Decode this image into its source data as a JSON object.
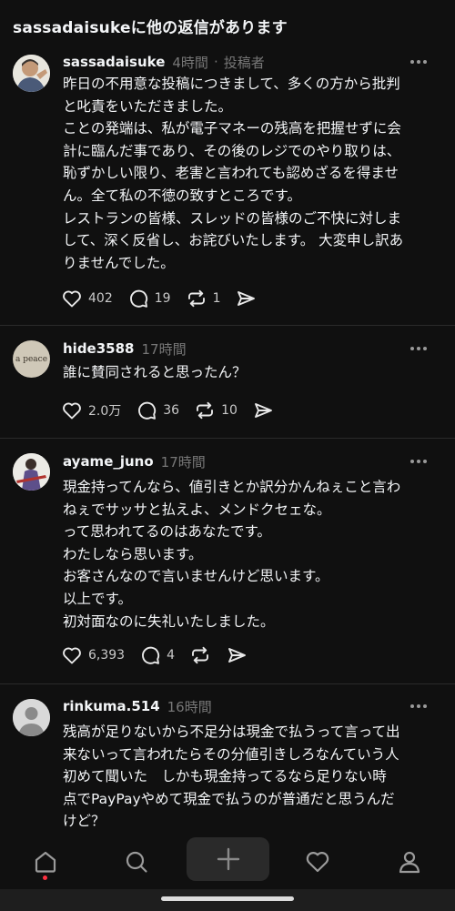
{
  "header": {
    "title": "sassadaisukeに他の返信があります"
  },
  "posts": [
    {
      "username": "sassadaisuke",
      "time": "4時間",
      "author_label": "投稿者",
      "lines": [
        "昨日の不用意な投稿につきまして、多くの方から批判",
        "と叱責をいただきました。",
        "ことの発端は、私が電子マネーの残高を把握せずに会",
        "計に臨んだ事であり、その後のレジでのやり取りは、",
        "恥ずかしい限り、老害と言われても認めざるを得ませ",
        "ん。全て私の不徳の致すところです。",
        "レストランの皆様、スレッドの皆様のご不快に対しま",
        "して、深く反省し、お詫びいたします。 大変申し訳あ",
        "りませんでした。"
      ],
      "likes": "402",
      "replies": "19",
      "reposts": "1"
    },
    {
      "username": "hide3588",
      "time": "17時間",
      "avatar_text": "a peace",
      "lines": [
        "誰に賛同されると思ったん？"
      ],
      "likes": "2.0万",
      "replies": "36",
      "reposts": "10"
    },
    {
      "username": "ayame_juno",
      "time": "17時間",
      "lines": [
        "現金持ってんなら、値引きとか訳分かんねぇこと言わ",
        "ねぇでサッサと払えよ、メンドクセェな。",
        "って思われてるのはあなたです。",
        "わたしなら思います。",
        "お客さんなので言いませんけど思います。",
        "以上です。",
        "初対面なのに失礼いたしました。"
      ],
      "likes": "6,393",
      "replies": "4",
      "reposts": ""
    },
    {
      "username": "rinkuma.514",
      "time": "16時間",
      "lines": [
        "残高が足りないから不足分は現金で払うって言って出",
        "来ないって言われたらその分値引きしろなんていう人",
        "初めて聞いた　しかも現金持ってるなら足りない時",
        "点でPayPayやめて現金で払うのが普通だと思うんだ",
        "けど？"
      ]
    }
  ],
  "icons": {
    "like": "heart-icon",
    "reply": "speech-bubble-icon",
    "repost": "repost-icon",
    "share": "send-icon",
    "more": "more-dots-icon"
  },
  "nav": [
    "home-icon",
    "search-icon",
    "plus-icon",
    "heart-icon",
    "profile-icon"
  ],
  "colors": {
    "background": "#101010",
    "text": "#f3f5f7",
    "muted": "#777777",
    "notification_dot": "#ff3040"
  }
}
